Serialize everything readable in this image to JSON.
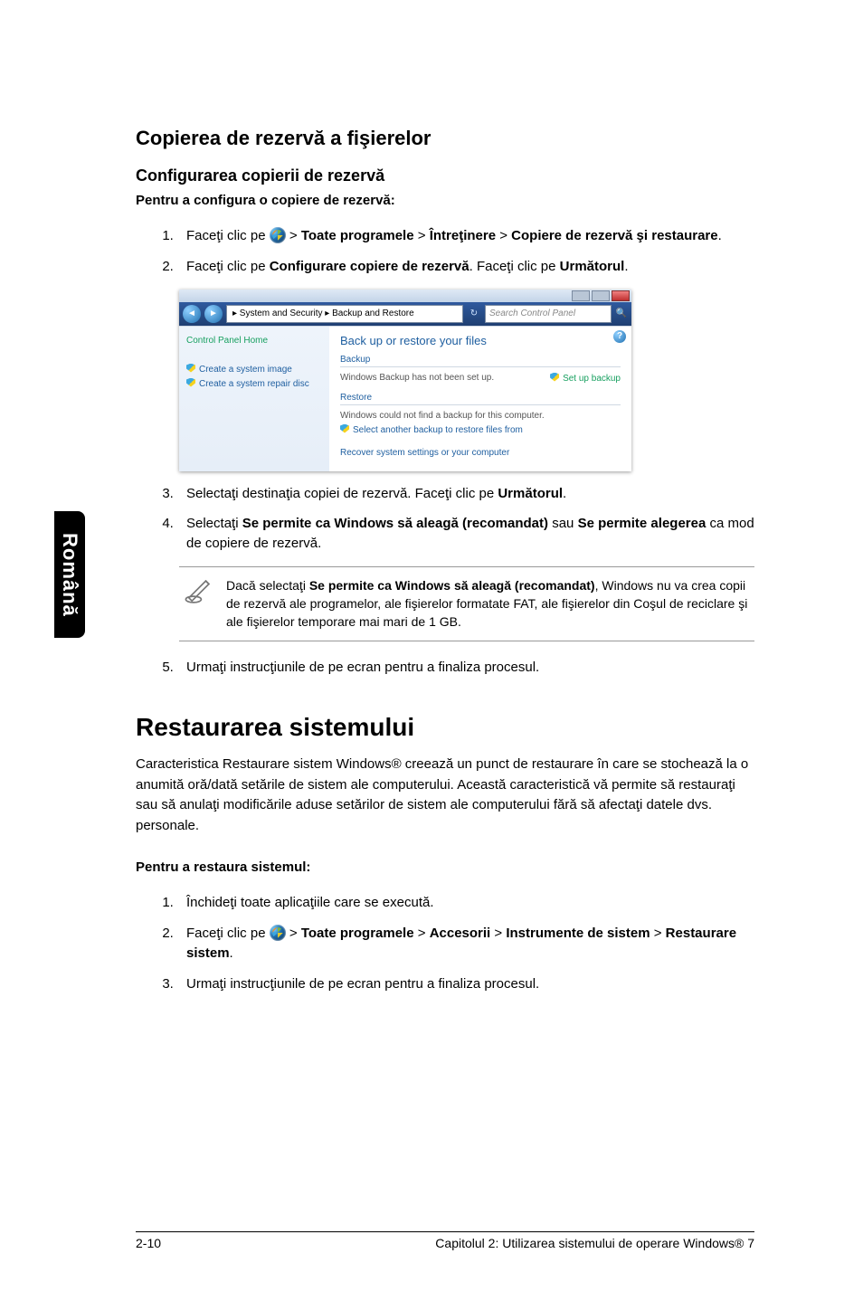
{
  "sideTab": "Română",
  "section1": {
    "title": "Copierea de rezervă a fişierelor",
    "subtitle": "Configurarea copierii de rezervă",
    "lead": "Pentru a configura o copiere de rezervă:",
    "steps": {
      "s1a": "Faceţi clic pe ",
      "s1b": " > ",
      "s1c": "Toate programele",
      "s1d": " > ",
      "s1e": "Întreţinere",
      "s1f": " > ",
      "s1g": "Copiere de rezervă şi restaurare",
      "s1h": ".",
      "s2a": "Faceţi clic pe ",
      "s2b": "Configurare copiere de rezervă",
      "s2c": ". Faceţi clic pe ",
      "s2d": "Următorul",
      "s2e": ".",
      "s3a": "Selectaţi destinaţia copiei de rezervă. Faceţi clic pe ",
      "s3b": "Următorul",
      "s3c": ".",
      "s4a": "Selectaţi ",
      "s4b": "Se permite ca Windows să aleagă (recomandat)",
      "s4c": " sau ",
      "s4d": "Se permite alegerea",
      "s4e": " ca mod de copiere de rezervă.",
      "s5": "Urmaţi instrucţiunile de pe ecran pentru a finaliza procesul."
    },
    "noteA": "Dacă selectaţi ",
    "noteB": "Se permite ca Windows să aleagă (recomandat)",
    "noteC": ", Windows nu va crea copii de rezervă ale programelor, ale fişierelor formatate FAT, ale fişierelor din Coşul de reciclare şi ale fişierelor temporare mai mari de 1 GB."
  },
  "screenshot": {
    "navPath": "▸ System and Security ▸ Backup and Restore",
    "searchPlaceholder": "Search Control Panel",
    "side": {
      "cpHome": "Control Panel Home",
      "createImage": "Create a system image",
      "createDisc": "Create a system repair disc"
    },
    "main": {
      "title": "Back up or restore your files",
      "backupLabel": "Backup",
      "backupLine": "Windows Backup has not been set up.",
      "setupLink": "Set up backup",
      "restoreLabel": "Restore",
      "restoreLine1": "Windows could not find a backup for this computer.",
      "restoreLine2": "Select another backup to restore files from",
      "recoverLine": "Recover system settings or your computer"
    }
  },
  "section2": {
    "title": "Restaurarea sistemului",
    "body": "Caracteristica Restaurare sistem Windows® creează un punct de restaurare în care se stochează la o anumită oră/dată setările de sistem ale computerului. Această caracteristică vă permite să restauraţi sau să anulaţi modificările aduse setărilor de sistem ale computerului fără să afectaţi datele dvs. personale.",
    "lead": "Pentru a restaura sistemul:",
    "steps": {
      "r1": "Închideţi toate aplicaţiile care se execută.",
      "r2a": "Faceţi clic pe ",
      "r2b": " > ",
      "r2c": "Toate programele",
      "r2d": " > ",
      "r2e": "Accesorii",
      "r2f": " > ",
      "r2g": "Instrumente de sistem",
      "r2h": " > ",
      "r2i": "Restaurare sistem",
      "r2j": ".",
      "r3": "Urmaţi instrucţiunile de pe ecran pentru a finaliza procesul."
    }
  },
  "footer": {
    "left": "2-10",
    "right": "Capitolul 2: Utilizarea sistemului de operare Windows® 7"
  }
}
